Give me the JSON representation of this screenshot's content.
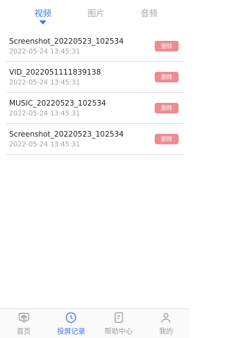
{
  "tabs": [
    {
      "label": "视频",
      "active": true
    },
    {
      "label": "图片",
      "active": false
    },
    {
      "label": "音频",
      "active": false
    }
  ],
  "records": [
    {
      "title": "Screenshot_20220523_102534",
      "time": "2022-05-24  13:45:31",
      "delete_label": "删除"
    },
    {
      "title": "VID_2022051111839138",
      "time": "2022-05-24  13:45:31",
      "delete_label": "删除"
    },
    {
      "title": "MUSIC_20220523_102534",
      "time": "2022-05-24  13:45:31",
      "delete_label": "删除"
    },
    {
      "title": "Screenshot_20220523_102534",
      "time": "2022-05-24  13:45:31",
      "delete_label": "删除"
    }
  ],
  "bottom_nav": [
    {
      "label": "首页",
      "icon": "screen-cast-icon",
      "active": false
    },
    {
      "label": "投屏记录",
      "icon": "clock-icon",
      "active": true
    },
    {
      "label": "帮助中心",
      "icon": "document-icon",
      "active": false
    },
    {
      "label": "我的",
      "icon": "user-icon",
      "active": false
    }
  ],
  "colors": {
    "accent": "#3b78e7",
    "delete_button": "#f08a92",
    "inactive": "#a7a7a7"
  }
}
